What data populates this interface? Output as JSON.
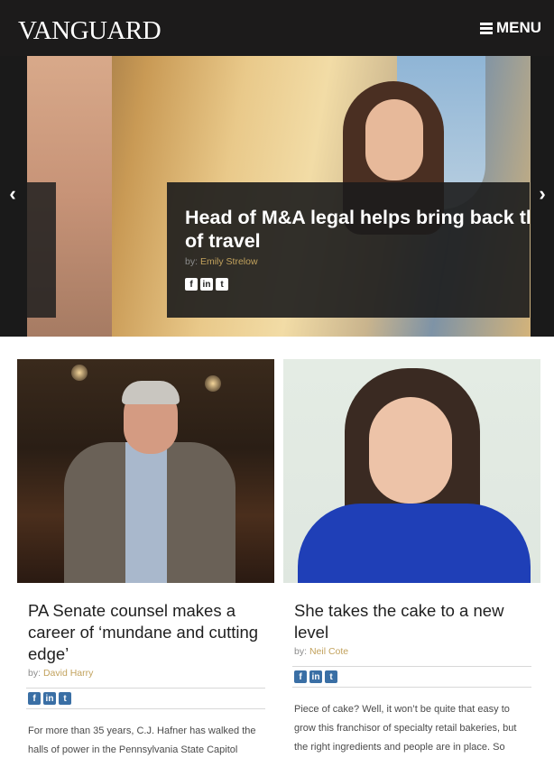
{
  "header": {
    "logo": "VANGUARD",
    "menu_label": "MENU"
  },
  "hero": {
    "title_line1": "Head of M&A legal helps bring back th",
    "title_line2": "of travel",
    "byline_prefix": "by:",
    "author": "Emily Strelow",
    "prev_arrow": "‹",
    "next_arrow": "›"
  },
  "social": {
    "facebook": "f",
    "linkedin": "in",
    "twitter": "t"
  },
  "cards": [
    {
      "title": "PA Senate counsel makes a career of ‘mundane and cutting edge’",
      "byline_prefix": "by:",
      "author": "David Harry",
      "excerpt": "For more than 35 years, C.J. Hafner has walked the halls of power in the Pennsylvania State Capitol"
    },
    {
      "title": "She takes the cake to a new level",
      "byline_prefix": "by:",
      "author": "Neil Cote",
      "excerpt": "Piece of cake? Well, it won’t be quite that easy to grow this franchisor of specialty retail bakeries, but the right ingredients and people are in place. So assures"
    }
  ],
  "colors": {
    "header_bg": "#1c1b1b",
    "author_link": "#c2a25d",
    "social_blue": "#3a6fa5"
  },
  "icons": [
    "menu-icon",
    "chevron-left-icon",
    "chevron-right-icon",
    "facebook-icon",
    "linkedin-icon",
    "twitter-icon"
  ]
}
